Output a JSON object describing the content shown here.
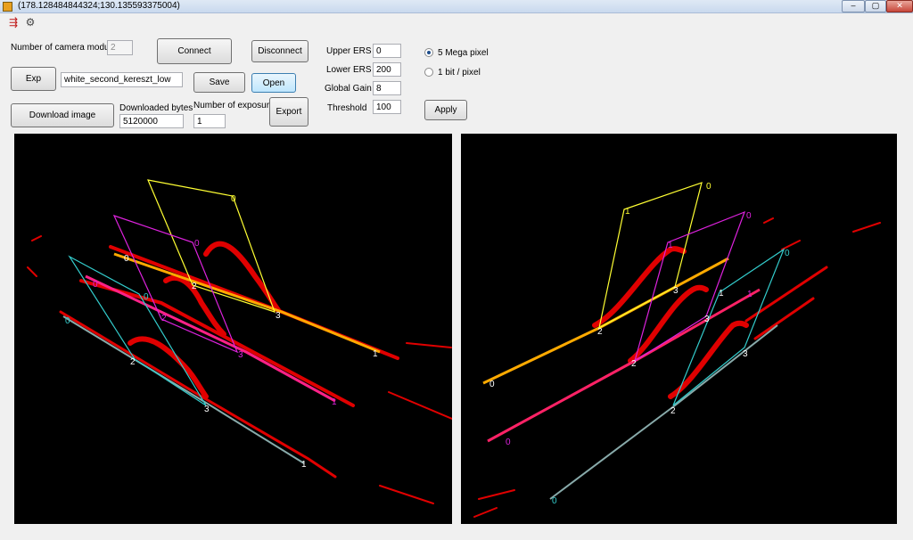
{
  "window": {
    "title": "(178.128484844324;130.135593375004)",
    "buttons": {
      "minimize": "–",
      "maximize": "▢",
      "close": "✕"
    }
  },
  "toolbar": {
    "icons": [
      "settings-wand-icon",
      "camera-icon"
    ]
  },
  "controls": {
    "camera_module_label": "Number of camera module:",
    "camera_module_value": "2",
    "connect_label": "Connect",
    "disconnect_label": "Disconnect",
    "exp_label": "Exp",
    "exp_name_value": "white_second_kereszt_low",
    "save_label": "Save",
    "open_label": "Open",
    "download_image_label": "Download image",
    "downloaded_bytes_label": "Downloaded bytes",
    "downloaded_bytes_value": "5120000",
    "num_exposures_label": "Number of exposures",
    "num_exposures_value": "1",
    "export_label": "Export",
    "upper_ers_label": "Upper ERS",
    "upper_ers_value": "0",
    "lower_ers_label": "Lower ERS",
    "lower_ers_value": "200",
    "global_gain_label": "Global Gain",
    "global_gain_value": "8",
    "threshold_label": "Threshold",
    "threshold_value": "100",
    "apply_label": "Apply",
    "radio_5mp_label": "5 Mega pixel",
    "radio_1bit_label": "1 bit / pixel",
    "selected_mode": "5 Mega pixel"
  },
  "colors": {
    "yellow": "#ffff33",
    "magenta": "#dd22dd",
    "cyan": "#33cccc",
    "red": "#e00000",
    "pink": "#ff2266",
    "orange": "#ff8800"
  },
  "left_view": {
    "labels": {
      "yellow_0": "0",
      "yellow_2": "2",
      "yellow_3": "3",
      "yellow_1": "1",
      "yellow_0b": "0",
      "magenta_0": "0",
      "magenta_2": "2",
      "magenta_3": "3",
      "magenta_1": "1",
      "magenta_0b": "0",
      "cyan_0": "0",
      "cyan_2": "2",
      "cyan_3": "3",
      "cyan_1": "1",
      "cyan_0b": "0"
    }
  },
  "right_view": {
    "labels": {
      "yellow_0": "0",
      "yellow_1": "1",
      "yellow_2": "2",
      "yellow_3": "3",
      "yellow_0b": "0",
      "magenta_0": "0",
      "magenta_1": "1",
      "magenta_2": "2",
      "magenta_3": "3",
      "magenta_0b": "0",
      "magenta_1b": "1",
      "cyan_0": "0",
      "cyan_1": "1",
      "cyan_2": "2",
      "cyan_3": "3",
      "cyan_0b": "0"
    }
  }
}
